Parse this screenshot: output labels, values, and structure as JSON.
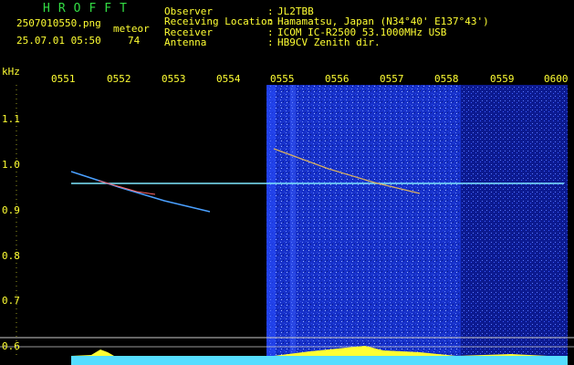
{
  "header": {
    "logo": "HROFFT",
    "filename": "2507010550.png",
    "datetime": "25.07.01 05:50",
    "meteor_label": "meteor",
    "meteor_count": "74"
  },
  "station": {
    "fields": [
      {
        "label": "Observer",
        "value": "JL2TBB"
      },
      {
        "label": "Receiving Location",
        "value": "Hamamatsu, Japan (N34°40' E137°43')"
      },
      {
        "label": "Receiver",
        "value": "ICOM IC-R2500 53.1000MHz USB"
      },
      {
        "label": "Antenna",
        "value": "HB9CV Zenith dir."
      }
    ]
  },
  "axes": {
    "y_unit": "kHz",
    "x_ticks": [
      "0551",
      "0552",
      "0553",
      "0554",
      "0555",
      "0556",
      "0557",
      "0558",
      "0559",
      "0600"
    ],
    "y_ticks": [
      "1.1",
      "1.0",
      "0.9",
      "0.8",
      "0.7",
      "0.6"
    ]
  },
  "colors": {
    "text": "#ffff33",
    "logo": "#33dd44",
    "noise_band": "#1a2fd0",
    "carrier": "#7fe8ff"
  }
}
